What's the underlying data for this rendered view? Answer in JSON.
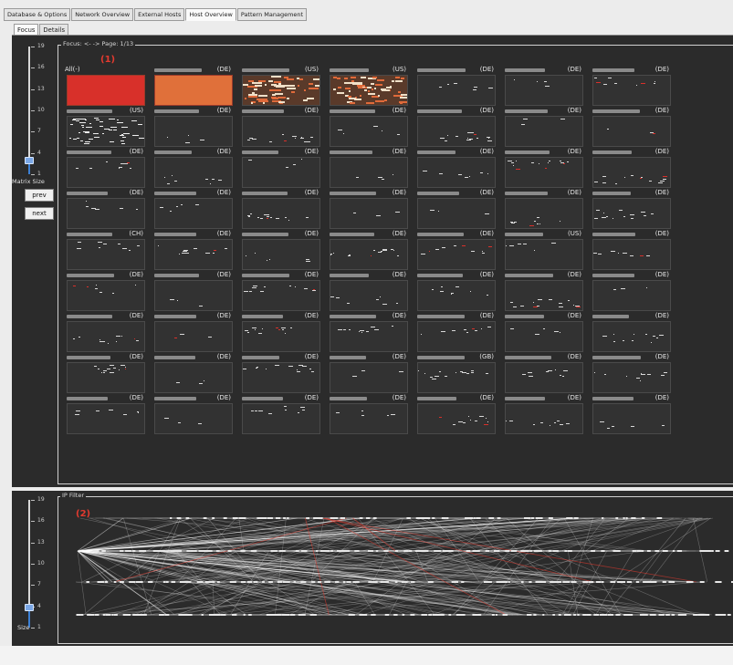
{
  "tabs": [
    "Database & Options",
    "Network Overview",
    "External Hosts",
    "Host Overview",
    "Pattern Management"
  ],
  "active_tab_index": 3,
  "sub_tabs": [
    "Focus",
    "Details"
  ],
  "active_sub_tab_index": 0,
  "matrix_panel": {
    "title": "Focus: <- -> Page: 1/13",
    "marker": "(1)",
    "slider_ticks": [
      "19",
      "16",
      "13",
      "10",
      "7",
      "4",
      "1"
    ],
    "slider_value": 3,
    "slider_label": "Matrix Size",
    "prev_label": "prev",
    "next_label": "next"
  },
  "cells": [
    [
      "All(-)",
      "(DE)",
      "(US)",
      "(US)",
      "(DE)",
      "(DE)",
      "(DE)"
    ],
    [
      "(US)",
      "(DE)",
      "(DE)",
      "(DE)",
      "(DE)",
      "(DE)",
      "(DE)"
    ],
    [
      "(DE)",
      "(DE)",
      "(DE)",
      "(DE)",
      "(DE)",
      "(DE)",
      "(DE)"
    ],
    [
      "(DE)",
      "(DE)",
      "(DE)",
      "(DE)",
      "(DE)",
      "(DE)",
      "(DE)"
    ],
    [
      "(CH)",
      "(DE)",
      "(DE)",
      "(DE)",
      "(DE)",
      "(US)",
      "(DE)"
    ],
    [
      "(DE)",
      "(DE)",
      "(DE)",
      "(DE)",
      "(DE)",
      "(DE)",
      "(DE)"
    ],
    [
      "(DE)",
      "(DE)",
      "(DE)",
      "(DE)",
      "(DE)",
      "(DE)",
      "(DE)"
    ],
    [
      "(DE)",
      "(DE)",
      "(DE)",
      "(DE)",
      "(GB)",
      "(DE)",
      "(DE)"
    ],
    [
      "(DE)",
      "(DE)",
      "(DE)",
      "(DE)",
      "(DE)",
      "(DE)",
      "(DE)"
    ]
  ],
  "filled_cells": {
    "0-0": "#d8302a",
    "0-1": "#e0703a"
  },
  "ip_panel": {
    "title": "IP Filter",
    "marker": "(2)",
    "slider_ticks": [
      "19",
      "16",
      "13",
      "10",
      "7",
      "4",
      "1"
    ],
    "slider_value": 4,
    "slider_label": "Size"
  },
  "colors": {
    "panel_bg": "#2b2b2b",
    "accent_red": "#e23a2f",
    "slider_blue": "#3b7fd4"
  }
}
